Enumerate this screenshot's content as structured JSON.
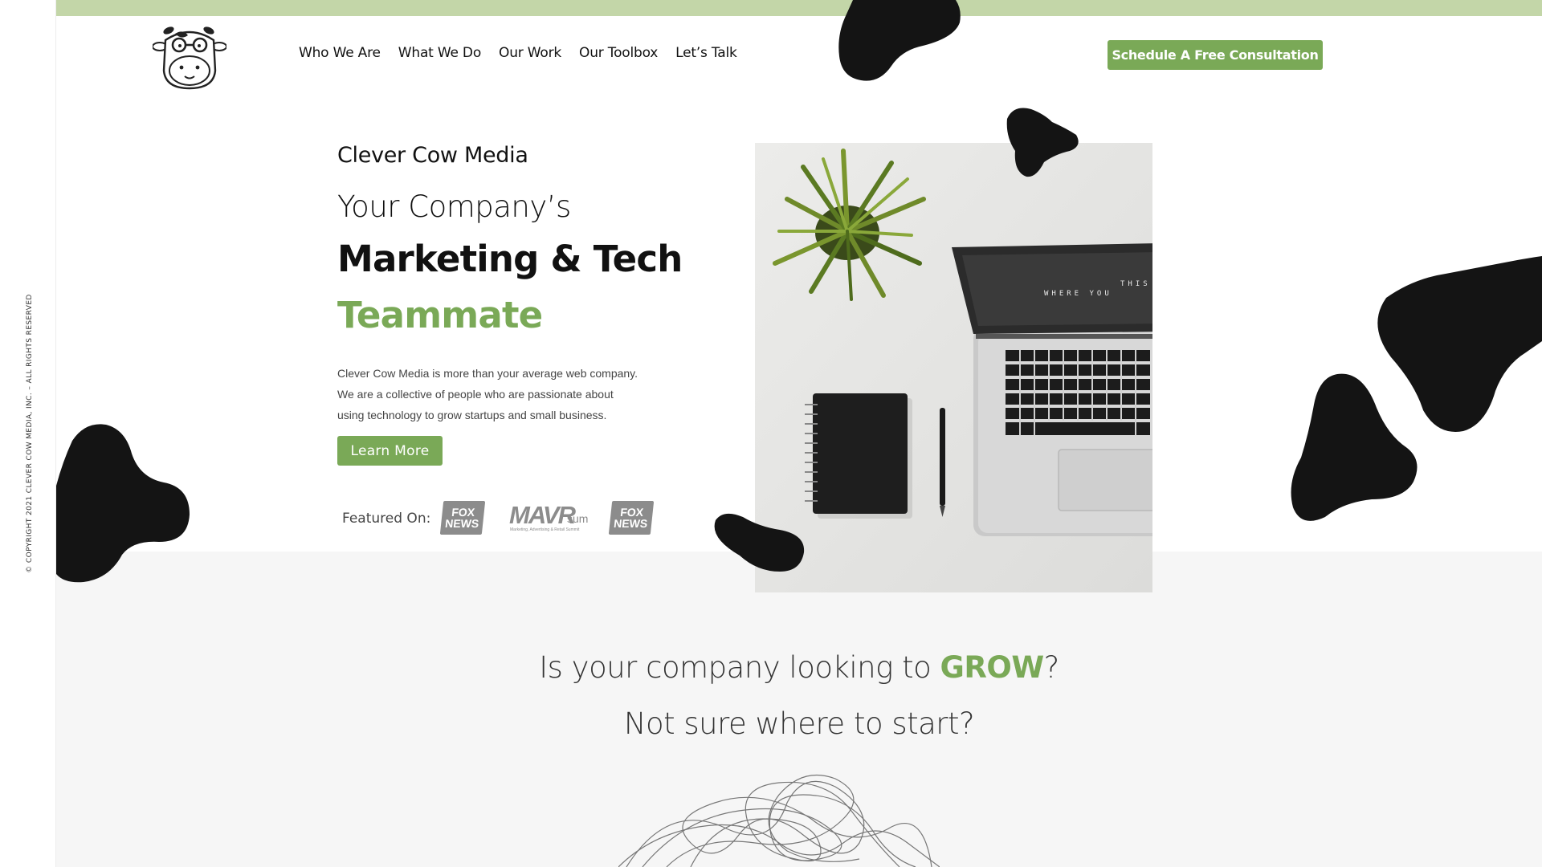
{
  "side_rail": {
    "copyright": "© COPYRIGHT 2021 CLEVER COW MEDIA, INC. – ALL RIGHTS RESERVED"
  },
  "header": {
    "logo_icon": "cow-face-logo",
    "nav": [
      {
        "label": "Who We Are"
      },
      {
        "label": "What We Do"
      },
      {
        "label": "Our Work"
      },
      {
        "label": "Our Toolbox"
      },
      {
        "label": "Let’s Talk"
      }
    ],
    "cta_label": "Schedule A Free Consultation"
  },
  "hero": {
    "brand": "Clever Cow Media",
    "line1": "Your Company’s",
    "line2": "Marketing & Tech",
    "line3": "Teammate",
    "description": [
      "Clever Cow Media is more than your average web company.",
      "We are a collective of people who are passionate about",
      "using technology to grow startups and small business."
    ],
    "button_label": "Learn More",
    "featured_label": "Featured On:",
    "featured_logos": [
      {
        "top": "FOX",
        "bottom": "NEWS"
      },
      {
        "main": "MAVR",
        "suffix": "sum",
        "tag": "Marketing, Advertising & Retail Summit"
      },
      {
        "top": "FOX",
        "bottom": "NEWS"
      }
    ],
    "laptop_screen_text": [
      "THIS IS",
      "WHERE YOU"
    ]
  },
  "section2": {
    "question_pre": "Is your company looking to ",
    "question_highlight": "GROW",
    "question_post": "?",
    "subtitle": "Not sure where to start?"
  },
  "colors": {
    "accent": "#7aa957",
    "top_bar": "#c3d6a8",
    "section_bg": "#f6f6f6",
    "blob": "#141414"
  }
}
